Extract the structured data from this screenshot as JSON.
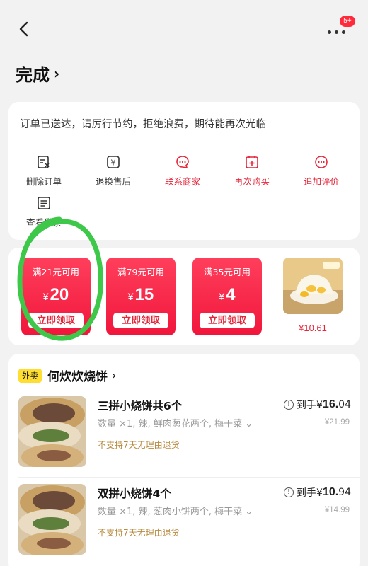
{
  "header": {
    "back_icon": "chevron-left-icon",
    "more_icon": "ellipsis-icon",
    "badge": "5+"
  },
  "status": {
    "title": "完成",
    "notice": "订单已送达，请厉行节约，拒绝浪费，期待能再次光临"
  },
  "actions": [
    {
      "label": "删除订单",
      "icon": "delete-order-icon",
      "color": "#333333"
    },
    {
      "label": "退换售后",
      "icon": "after-sales-icon",
      "color": "#333333"
    },
    {
      "label": "联系商家",
      "icon": "chat-icon",
      "color": "#e4253a"
    },
    {
      "label": "再次购买",
      "icon": "calendar-plus-icon",
      "color": "#e4253a"
    },
    {
      "label": "追加评价",
      "icon": "comment-icon",
      "color": "#e4253a"
    },
    {
      "label": "查看发票",
      "icon": "invoice-icon",
      "color": "#333333"
    }
  ],
  "coupons": [
    {
      "condition": "满21元可用",
      "currency": "¥",
      "amount": "20",
      "claim": "立即领取"
    },
    {
      "condition": "满79元可用",
      "currency": "¥",
      "amount": "15",
      "claim": "立即领取"
    },
    {
      "condition": "满35元可用",
      "currency": "¥",
      "amount": "4",
      "claim": "立即领取"
    }
  ],
  "promo_product": {
    "price": "¥10.61"
  },
  "order": {
    "tag": "外卖",
    "shop_name": "何炊炊烧饼",
    "items": [
      {
        "name": "三拼小烧饼共6个",
        "spec": "数量 ×1, 辣, 鲜肉葱花两个, 梅干菜",
        "note": "不支持7天无理由退货",
        "price_label": "到手¥",
        "price_main": "16.",
        "price_dec": "04",
        "original_price": "¥21.99"
      },
      {
        "name": "双拼小烧饼4个",
        "spec": "数量 ×1, 辣, 葱肉小饼两个, 梅干菜",
        "note": "不支持7天无理由退货",
        "price_label": "到手¥",
        "price_main": "10.",
        "price_dec": "94",
        "original_price": "¥14.99"
      }
    ]
  },
  "colors": {
    "accent": "#e4253a",
    "annotation": "#3ec84a",
    "tag": "#ffde32"
  }
}
